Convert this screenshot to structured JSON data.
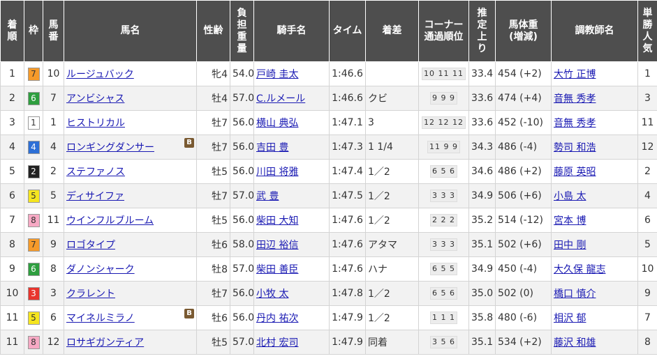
{
  "headers": {
    "rank": "着順",
    "waku": "枠",
    "umaban": "馬番",
    "horse": "馬名",
    "sexage": "性齢",
    "weight": "負担重量",
    "jockey": "騎手名",
    "time": "タイム",
    "margin": "着差",
    "corner": "コーナー通過順位",
    "last3f": "推定上り",
    "bodyweight": "馬体重(増減)",
    "trainer": "調教師名",
    "popularity": "単勝人気"
  },
  "blinker_label": "B",
  "waku_colors": {
    "1": {
      "bg": "#ffffff",
      "fg": "#333333"
    },
    "2": {
      "bg": "#222222",
      "fg": "#ffffff"
    },
    "3": {
      "bg": "#e8342d",
      "fg": "#ffffff"
    },
    "4": {
      "bg": "#2d6fd6",
      "fg": "#ffffff"
    },
    "5": {
      "bg": "#f5e51f",
      "fg": "#333333"
    },
    "6": {
      "bg": "#2e9e3f",
      "fg": "#ffffff"
    },
    "7": {
      "bg": "#f59a2a",
      "fg": "#333333"
    },
    "8": {
      "bg": "#f7a9c4",
      "fg": "#333333"
    }
  },
  "rows": [
    {
      "rank": "1",
      "waku": "7",
      "umaban": "10",
      "horse": "ルージュバック",
      "blinker": false,
      "sexage": "牝4",
      "weight": "54.0",
      "jockey": "戸崎 圭太",
      "time": "1:46.6",
      "margin": "",
      "corner": "10 11 11",
      "last3f": "33.4",
      "bodyweight": "454 (+2)",
      "trainer": "大竹 正博",
      "popularity": "1"
    },
    {
      "rank": "2",
      "waku": "6",
      "umaban": "7",
      "horse": "アンビシャス",
      "blinker": false,
      "sexage": "牡4",
      "weight": "57.0",
      "jockey": "C.ルメール",
      "time": "1:46.6",
      "margin": "クビ",
      "corner": "9 9 9",
      "last3f": "33.6",
      "bodyweight": "474 (+4)",
      "trainer": "音無 秀孝",
      "popularity": "3"
    },
    {
      "rank": "3",
      "waku": "1",
      "umaban": "1",
      "horse": "ヒストリカル",
      "blinker": false,
      "sexage": "牡7",
      "weight": "56.0",
      "jockey": "横山 典弘",
      "time": "1:47.1",
      "margin": "3",
      "corner": "12 12 12",
      "last3f": "33.6",
      "bodyweight": "452 (-10)",
      "trainer": "音無 秀孝",
      "popularity": "11"
    },
    {
      "rank": "4",
      "waku": "4",
      "umaban": "4",
      "horse": "ロンギングダンサー",
      "blinker": true,
      "sexage": "牡7",
      "weight": "56.0",
      "jockey": "吉田 豊",
      "time": "1:47.3",
      "margin": "1 1/4",
      "corner": "11 9 9",
      "last3f": "34.3",
      "bodyweight": "486 (-4)",
      "trainer": "勢司 和浩",
      "popularity": "12"
    },
    {
      "rank": "5",
      "waku": "2",
      "umaban": "2",
      "horse": "ステファノス",
      "blinker": false,
      "sexage": "牡5",
      "weight": "56.0",
      "jockey": "川田 将雅",
      "time": "1:47.4",
      "margin": "1／2",
      "corner": "6 5 6",
      "last3f": "34.6",
      "bodyweight": "486 (+2)",
      "trainer": "藤原 英昭",
      "popularity": "2"
    },
    {
      "rank": "6",
      "waku": "5",
      "umaban": "5",
      "horse": "ディサイファ",
      "blinker": false,
      "sexage": "牡7",
      "weight": "57.0",
      "jockey": "武 豊",
      "time": "1:47.5",
      "margin": "1／2",
      "corner": "3 3 3",
      "last3f": "34.9",
      "bodyweight": "506 (+6)",
      "trainer": "小島 太",
      "popularity": "4"
    },
    {
      "rank": "7",
      "waku": "8",
      "umaban": "11",
      "horse": "ウインフルブルーム",
      "blinker": false,
      "sexage": "牡5",
      "weight": "56.0",
      "jockey": "柴田 大知",
      "time": "1:47.6",
      "margin": "1／2",
      "corner": "2 2 2",
      "last3f": "35.2",
      "bodyweight": "514 (-12)",
      "trainer": "宮本 博",
      "popularity": "6"
    },
    {
      "rank": "8",
      "waku": "7",
      "umaban": "9",
      "horse": "ロゴタイプ",
      "blinker": false,
      "sexage": "牡6",
      "weight": "58.0",
      "jockey": "田辺 裕信",
      "time": "1:47.6",
      "margin": "アタマ",
      "corner": "3 3 3",
      "last3f": "35.1",
      "bodyweight": "502 (+6)",
      "trainer": "田中 剛",
      "popularity": "5"
    },
    {
      "rank": "9",
      "waku": "6",
      "umaban": "8",
      "horse": "ダノンシャーク",
      "blinker": false,
      "sexage": "牡8",
      "weight": "57.0",
      "jockey": "柴田 善臣",
      "time": "1:47.6",
      "margin": "ハナ",
      "corner": "6 5 5",
      "last3f": "34.9",
      "bodyweight": "450 (-4)",
      "trainer": "大久保 龍志",
      "popularity": "10"
    },
    {
      "rank": "10",
      "waku": "3",
      "umaban": "3",
      "horse": "クラレント",
      "blinker": false,
      "sexage": "牡7",
      "weight": "56.0",
      "jockey": "小牧 太",
      "time": "1:47.8",
      "margin": "1／2",
      "corner": "6 5 6",
      "last3f": "35.0",
      "bodyweight": "502 (0)",
      "trainer": "橋口 慎介",
      "popularity": "9"
    },
    {
      "rank": "11",
      "waku": "5",
      "umaban": "6",
      "horse": "マイネルミラノ",
      "blinker": true,
      "sexage": "牡6",
      "weight": "56.0",
      "jockey": "丹内 祐次",
      "time": "1:47.9",
      "margin": "1／2",
      "corner": "1 1 1",
      "last3f": "35.8",
      "bodyweight": "480 (-6)",
      "trainer": "相沢 郁",
      "popularity": "7"
    },
    {
      "rank": "11",
      "waku": "8",
      "umaban": "12",
      "horse": "ロサギガンティア",
      "blinker": false,
      "sexage": "牡5",
      "weight": "57.0",
      "jockey": "北村 宏司",
      "time": "1:47.9",
      "margin": "同着",
      "corner": "3 5 6",
      "last3f": "35.1",
      "bodyweight": "534 (+2)",
      "trainer": "藤沢 和雄",
      "popularity": "8"
    }
  ]
}
